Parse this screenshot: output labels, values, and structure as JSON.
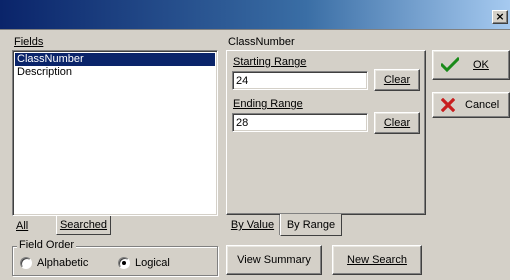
{
  "window": {
    "title": "",
    "close_glyph": "×"
  },
  "fields_panel": {
    "label": "Fields",
    "items": [
      "ClassNumber",
      "Description"
    ],
    "selected_index": 0
  },
  "list_tabs": {
    "all": "All",
    "searched": "Searched"
  },
  "field_order": {
    "legend": "Field Order",
    "options": [
      "Alphabetic",
      "Logical"
    ],
    "selected": "Logical"
  },
  "range_panel": {
    "field_name": "ClassNumber",
    "starting_label": "Starting Range",
    "starting_value": "24",
    "ending_label": "Ending Range",
    "ending_value": "28",
    "clear_label": "Clear"
  },
  "view_tabs": {
    "by_value": "By Value",
    "by_range": "By Range",
    "active": "By Range"
  },
  "actions": {
    "ok": "OK",
    "cancel": "Cancel",
    "view_summary": "View Summary",
    "new_search": "New Search"
  },
  "colors": {
    "ok_check": "#1a8a1a",
    "cancel_x": "#c81e1e",
    "selection": "#0a246a"
  }
}
